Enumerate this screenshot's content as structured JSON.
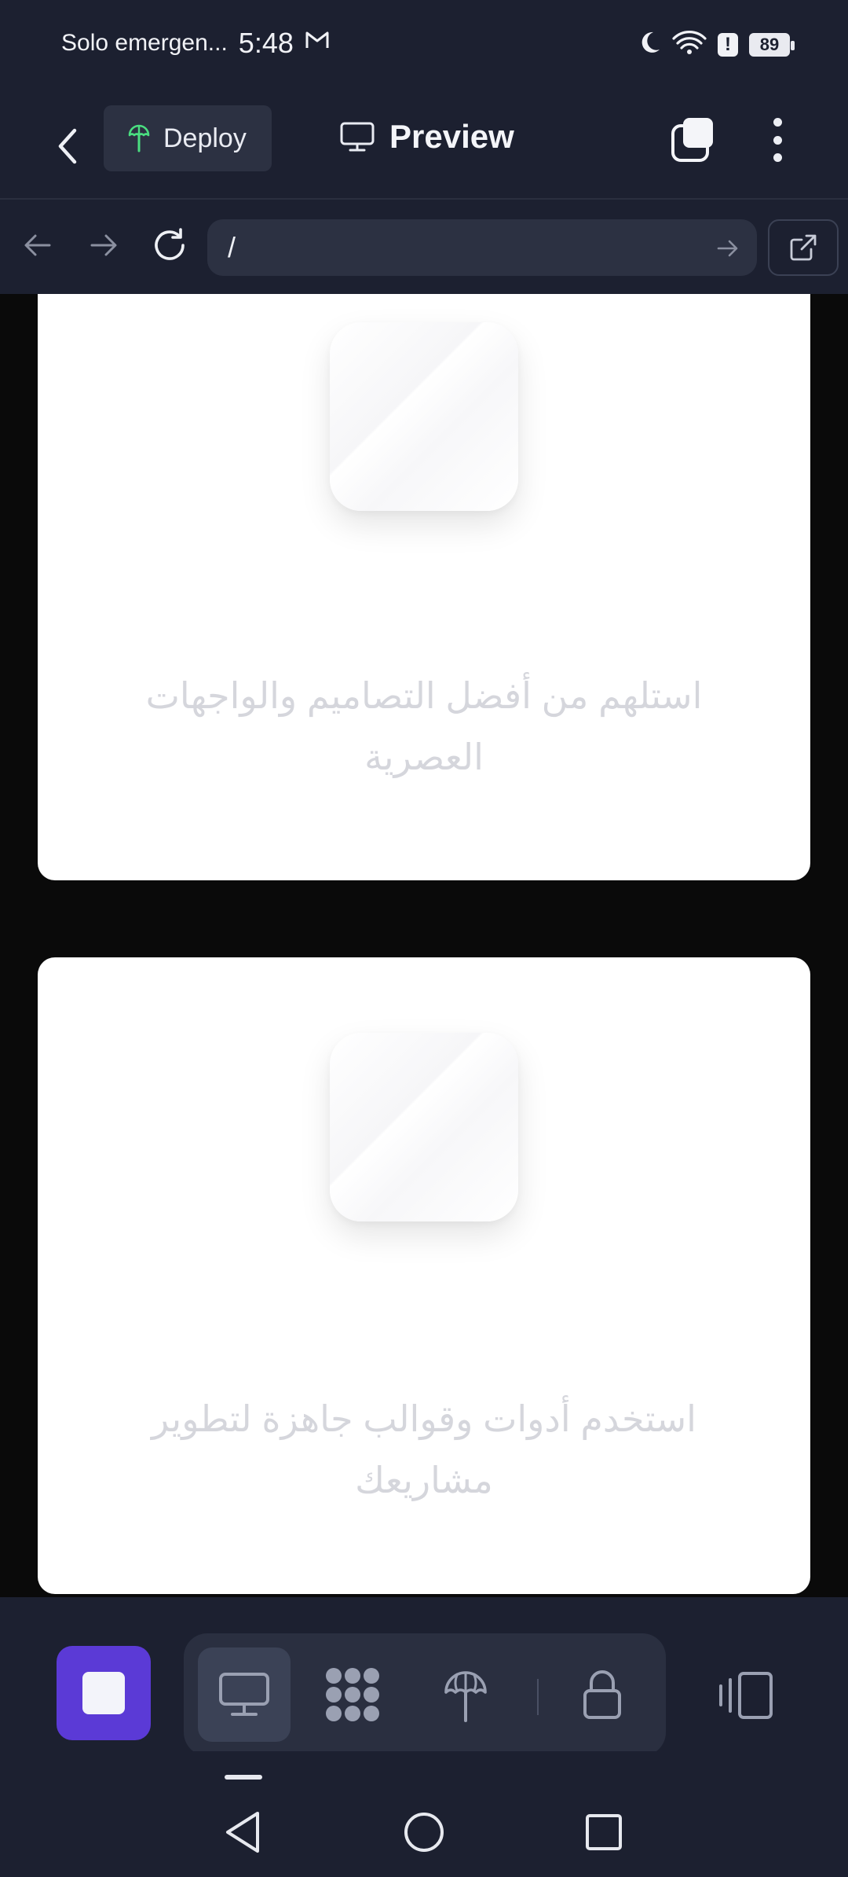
{
  "status_bar": {
    "carrier": "Solo emergen...",
    "time": "5:48",
    "battery": "89"
  },
  "app_bar": {
    "deploy_label": "Deploy",
    "preview_label": "Preview"
  },
  "url_bar": {
    "url": "/"
  },
  "cards": [
    {
      "text": "استلهم من أفضل التصاميم والواجهات العصرية"
    },
    {
      "text": "استخدم أدوات وقوالب جاهزة لتطوير مشاريعك"
    }
  ],
  "toolbar": {
    "stop_color": "#5b3ad6",
    "items": [
      "desktop-icon",
      "apps-icon",
      "deploy-icon",
      "lock-icon"
    ],
    "active_item": "desktop-icon"
  },
  "colors": {
    "background": "#1c2030",
    "content_background": "#0a0a0a",
    "card": "#ffffff",
    "deploy_icon": "#4ade80",
    "accent": "#5b3ad6"
  }
}
